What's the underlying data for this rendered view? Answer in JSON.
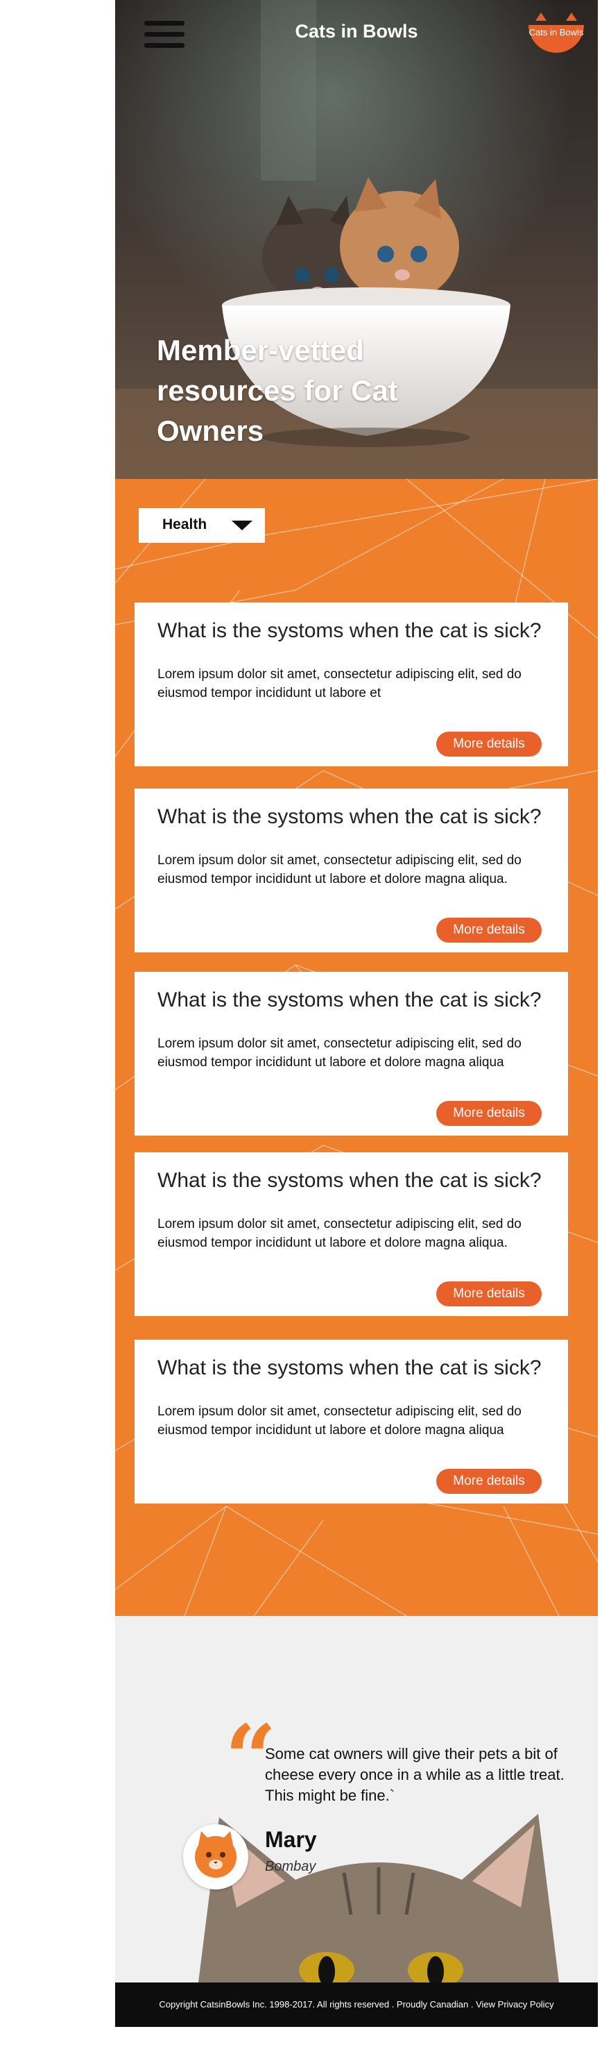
{
  "header": {
    "site_title": "Cats in Bowls",
    "logo_text": "Cats in Bowls"
  },
  "hero": {
    "heading": "Member-vetted resources for Cat Owners"
  },
  "filter": {
    "selected": "Health"
  },
  "cards": [
    {
      "title": "What is the systoms when the cat is sick?",
      "text": "Lorem ipsum dolor sit amet, consectetur adipiscing elit, sed do eiusmod tempor incididunt ut labore et",
      "button": "More details"
    },
    {
      "title": "What is the systoms when the cat is sick?",
      "text": "Lorem ipsum dolor sit amet, consectetur adipiscing elit, sed do eiusmod tempor incididunt ut labore et dolore magna aliqua.",
      "button": "More details"
    },
    {
      "title": "What is the systoms when the cat is sick?",
      "text": "Lorem ipsum dolor sit amet, consectetur adipiscing elit, sed do eiusmod tempor incididunt ut labore et dolore magna aliqua",
      "button": "More details"
    },
    {
      "title": "What is the systoms when the cat is sick?",
      "text": "Lorem ipsum dolor sit amet, consectetur adipiscing elit, sed do eiusmod tempor incididunt ut labore et dolore magna aliqua.",
      "button": "More details"
    },
    {
      "title": "What is the systoms when the cat is sick?",
      "text": "Lorem ipsum dolor sit amet, consectetur adipiscing elit, sed do eiusmod tempor incididunt ut labore et dolore magna aliqua",
      "button": "More details"
    }
  ],
  "testimonial": {
    "quote": "Some cat owners will give their pets a bit of cheese every once in a while as a little treat. This might be fine.`",
    "author": "Mary",
    "breed": "Bombay"
  },
  "footer": {
    "copyright": "Copyright CatsinBowls Inc. 1998-2017. All rights reserved . Proudly Canadian . ",
    "privacy_link": "View Privacy Policy"
  },
  "colors": {
    "accent": "#f07f2c",
    "button": "#e8602a",
    "footer": "#0d0d0d"
  },
  "icons": {
    "menu": "hamburger-icon",
    "dropdown": "caret-down-icon",
    "quote": "quote-icon",
    "avatar": "cat-face-icon"
  }
}
